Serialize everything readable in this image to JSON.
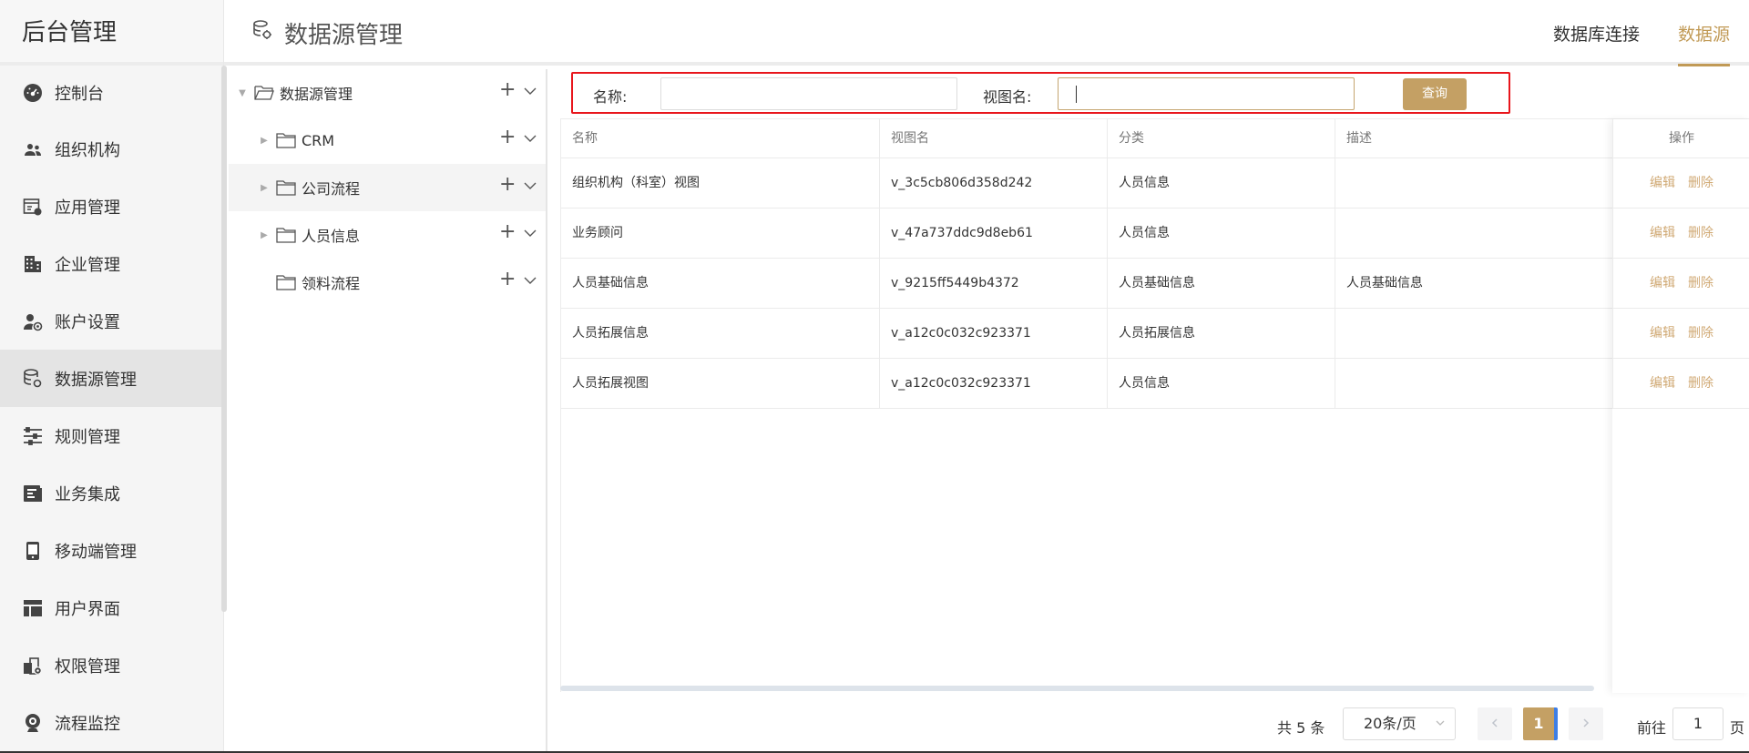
{
  "app_title": "后台管理",
  "sidebar": {
    "items": [
      {
        "label": "控制台",
        "icon": "dashboard-icon"
      },
      {
        "label": "组织机构",
        "icon": "users-icon"
      },
      {
        "label": "应用管理",
        "icon": "app-settings-icon"
      },
      {
        "label": "企业管理",
        "icon": "building-icon"
      },
      {
        "label": "账户设置",
        "icon": "user-settings-icon"
      },
      {
        "label": "数据源管理",
        "icon": "database-icon",
        "active": true
      },
      {
        "label": "规则管理",
        "icon": "sliders-icon"
      },
      {
        "label": "业务集成",
        "icon": "integration-icon"
      },
      {
        "label": "移动端管理",
        "icon": "mobile-icon"
      },
      {
        "label": "用户界面",
        "icon": "layout-icon"
      },
      {
        "label": "权限管理",
        "icon": "permission-icon"
      },
      {
        "label": "流程监控",
        "icon": "webcam-icon"
      }
    ]
  },
  "header": {
    "title": "数据源管理",
    "tabs": [
      {
        "label": "数据库连接",
        "active": false
      },
      {
        "label": "数据源",
        "active": true
      }
    ]
  },
  "tree": {
    "nodes": [
      {
        "label": "数据源管理",
        "level": 0,
        "expanded": true,
        "has_children": true
      },
      {
        "label": "CRM",
        "level": 1,
        "has_children": true
      },
      {
        "label": "公司流程",
        "level": 1,
        "has_children": true,
        "selected": true
      },
      {
        "label": "人员信息",
        "level": 1,
        "has_children": true
      },
      {
        "label": "领料流程",
        "level": 1,
        "has_children": false
      }
    ]
  },
  "search": {
    "name_label": "名称:",
    "name_value": "",
    "view_label": "视图名:",
    "view_value": "",
    "query_button": "查询"
  },
  "table": {
    "columns": [
      "名称",
      "视图名",
      "分类",
      "描述",
      "操作"
    ],
    "rows": [
      {
        "name": "组织机构（科室）视图",
        "view": "v_3c5cb806d358d242",
        "category": "人员信息",
        "desc": ""
      },
      {
        "name": "业务顾问",
        "view": "v_47a737ddc9d8eb61",
        "category": "人员信息",
        "desc": ""
      },
      {
        "name": "人员基础信息",
        "view": "v_9215ff5449b4372",
        "category": "人员基础信息",
        "desc": "人员基础信息"
      },
      {
        "name": "人员拓展信息",
        "view": "v_a12c0c032c923371",
        "category": "人员拓展信息",
        "desc": ""
      },
      {
        "name": "人员拓展视图",
        "view": "v_a12c0c032c923371",
        "category": "人员信息",
        "desc": ""
      }
    ],
    "edit_label": "编辑",
    "delete_label": "删除"
  },
  "pager": {
    "total": "共 5 条",
    "page_size": "20条/页",
    "current": "1",
    "goto_label": "前往",
    "goto_value": "1",
    "page_unit": "页"
  },
  "colors": {
    "accent": "#c4a064",
    "highlight_border": "#e8161c"
  }
}
